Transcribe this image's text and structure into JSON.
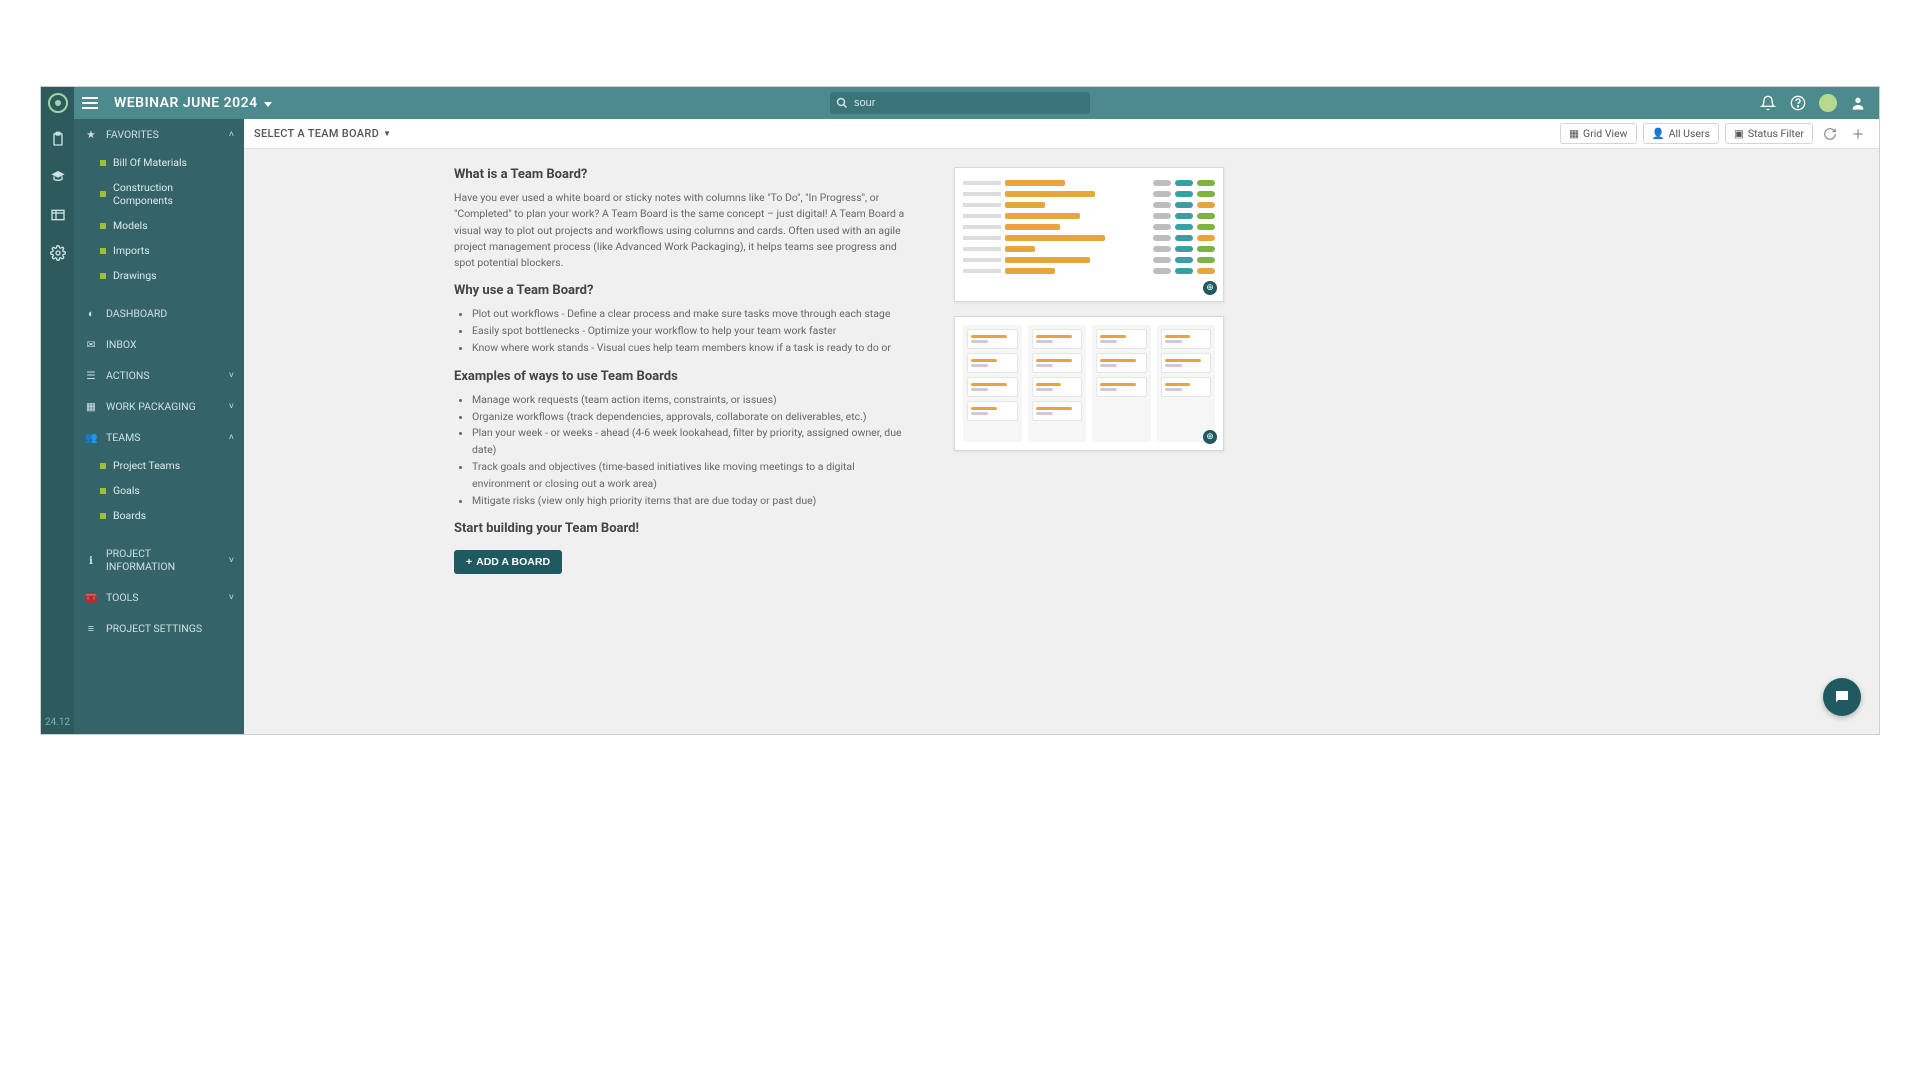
{
  "header": {
    "project_title": "WEBINAR JUNE 2024",
    "search_value": "sour"
  },
  "rail": {
    "version": "24.12"
  },
  "sidebar": {
    "favorites": {
      "label": "FAVORITES",
      "items": [
        "Bill Of Materials",
        "Construction Components",
        "Models",
        "Imports",
        "Drawings"
      ]
    },
    "dashboard": "DASHBOARD",
    "inbox": "INBOX",
    "actions": "ACTIONS",
    "work_packaging": "WORK PACKAGING",
    "teams": {
      "label": "TEAMS",
      "items": [
        "Project Teams",
        "Goals",
        "Boards"
      ]
    },
    "project_information": "PROJECT INFORMATION",
    "tools": "TOOLS",
    "project_settings": "PROJECT SETTINGS"
  },
  "toolbar": {
    "board_select": "SELECT A TEAM BOARD",
    "grid_view": "Grid View",
    "all_users": "All Users",
    "status_filter": "Status Filter"
  },
  "article": {
    "h_what": "What is a Team Board?",
    "p_what": "Have you ever used a white board or sticky notes with columns like \"To Do\", \"In Progress\", or \"Completed\" to plan your work? A Team Board is the same concept – just digital! A Team Board a visual way to plot out projects and workflows using columns and cards. Often used with an agile project management process (like Advanced Work Packaging), it helps teams see progress and spot potential blockers.",
    "h_why": "Why use a Team Board?",
    "why_items": [
      "Plot out workflows - Define a clear process and make sure tasks move through each stage",
      "Easily spot bottlenecks - Optimize your workflow to help your team work faster",
      "Know where work stands - Visual cues help team members know if a task is ready to do or"
    ],
    "h_examples": "Examples of ways to use Team Boards",
    "example_items": [
      "Manage work requests (team action items, constraints, or issues)",
      "Organize workflows (track dependencies, approvals, collaborate on deliverables, etc.)",
      "Plan your week - or weeks - ahead (4-6 week lookahead, filter by priority, assigned owner, due date)",
      "Track goals and objectives (time-based initiatives like moving meetings to a digital environment or closing out a work area)",
      "Mitigate risks (view only high priority items that are due today or past due)"
    ],
    "h_start": "Start building your Team Board!",
    "add_board_btn": "ADD A BOARD"
  }
}
